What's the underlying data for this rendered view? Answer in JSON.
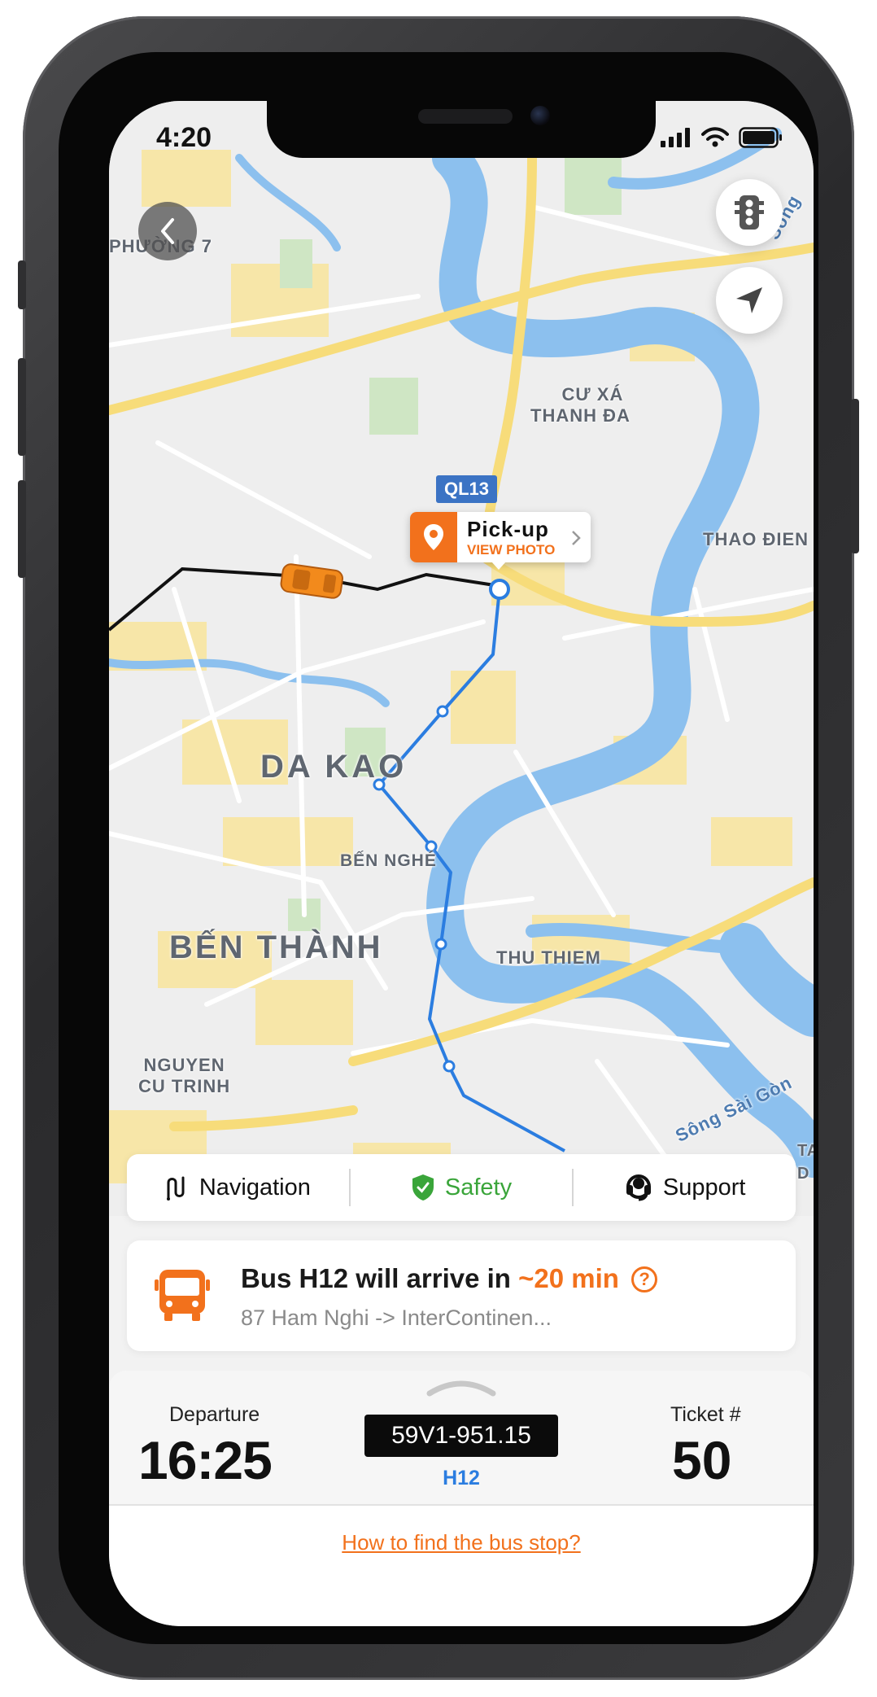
{
  "status_bar": {
    "time": "4:20"
  },
  "map": {
    "labels": {
      "phuong7": "PHƯỜNG 7",
      "cu_xa_thanh_da": [
        "CƯ XÁ",
        "THANH ĐA"
      ],
      "thao_dien": "THAO ĐIEN",
      "da_kao": "DA KAO",
      "ben_nghe": "BẾN NGHÉ",
      "ben_thanh": "BẾN THÀNH",
      "thu_thiem": "THU THIEM",
      "nguyen_cu_trinh": [
        "NGUYEN",
        "CU TRINH"
      ],
      "song_sai_gon_1": "Sông Sài Gòn",
      "song_partial": "Sông",
      "tan": [
        "TAN",
        "D"
      ]
    },
    "road_sign": "QL13",
    "pickup": {
      "title": "Pick-up",
      "subtitle": "VIEW PHOTO"
    },
    "colors": {
      "route": "#2b7de0",
      "accent": "#f2711c",
      "water": "#8cc0ee"
    }
  },
  "actions": {
    "navigation": "Navigation",
    "safety": "Safety",
    "support": "Support"
  },
  "bus_card": {
    "title_prefix": "Bus H12 will arrive in ",
    "eta": "~20 min",
    "help_icon": "?",
    "route": "87 Ham Nghi  -> InterContinen..."
  },
  "trip": {
    "departure_label": "Departure",
    "departure_time": "16:25",
    "plate": "59V1-951.15",
    "route_no": "H12",
    "ticket_label": "Ticket #",
    "ticket_no": "50"
  },
  "help_link": "How to find the bus stop?"
}
